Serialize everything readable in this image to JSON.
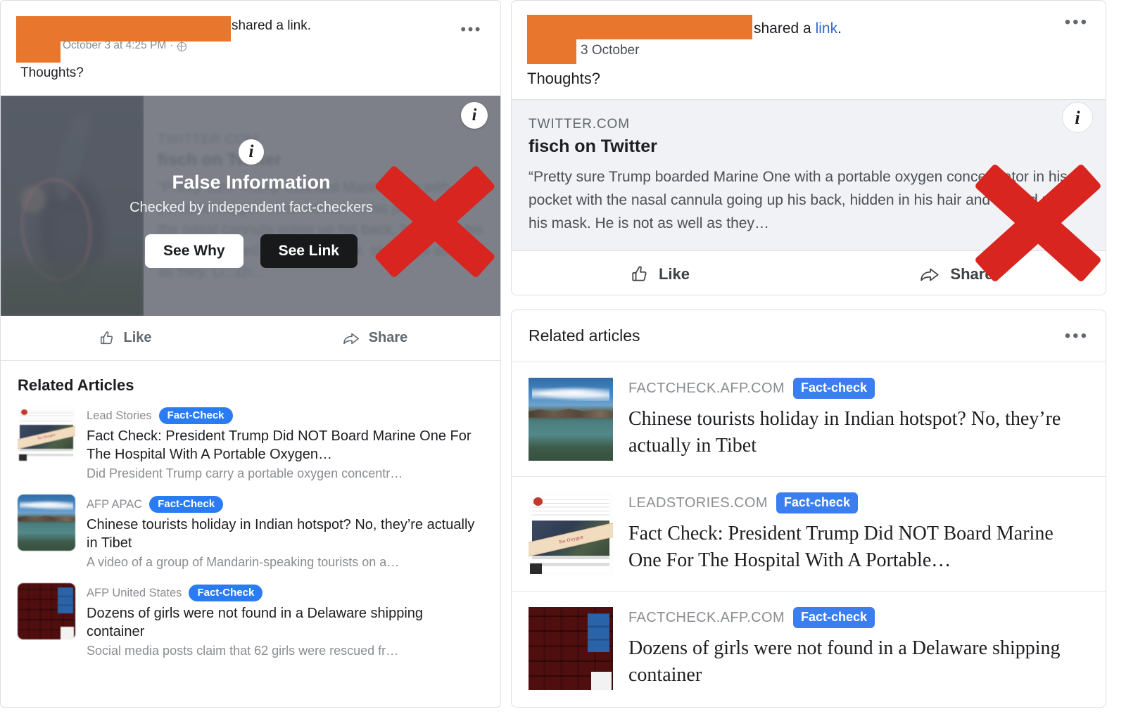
{
  "colors": {
    "redaction": "#e8762c",
    "badge_blue_left": "#2a7cf5",
    "badge_blue_right": "#3b7ef0",
    "link_blue": "#2b6bd4",
    "red_x": "#d8251f",
    "overlay_dark_button": "#18191a"
  },
  "left_panel": {
    "byline_suffix": "shared a link.",
    "timestamp": "October 3 at 4:25 PM",
    "privacy_icon": "globe-icon",
    "menu_icon": "ellipsis-icon",
    "post_text": "Thoughts?",
    "link_preview_blurred": {
      "domain": "TWITTER.COM",
      "title": "fisch on Twitter",
      "description": "\"Pretty sure Trump boarded Marine One with a portable oxygen concentrator in his pocket with the nasal cannula going up his back, hidden in his hair and tucked under his mask. He is not as well as they. Li...ch..."
    },
    "false_info_overlay": {
      "info_icon": "info-icon",
      "title": "False Information",
      "subtitle": "Checked by independent fact-checkers",
      "primary_button": "See Why",
      "secondary_button": "See Link"
    },
    "corner_info_icon": "info-icon",
    "actions": [
      {
        "label": "Like",
        "icon": "thumbs-up-icon"
      },
      {
        "label": "Share",
        "icon": "share-arrow-icon"
      }
    ],
    "related_title": "Related Articles",
    "related_articles": [
      {
        "source": "Lead Stories",
        "badge": "Fact-Check",
        "headline": "Fact Check: President Trump Did NOT Board Marine One For The Hospital With A Portable Oxygen…",
        "snippet": "Did President Trump carry a portable oxygen concentr…",
        "thumb": "leadstories-no-oxygen"
      },
      {
        "source": "AFP APAC",
        "badge": "Fact-Check",
        "headline": "Chinese tourists holiday in Indian hotspot? No, they’re actually in Tibet",
        "snippet": "A video of a group of Mandarin-speaking tourists on a…",
        "thumb": "lake-mountain"
      },
      {
        "source": "AFP United States",
        "badge": "Fact-Check",
        "headline": "Dozens of girls were not found in a Delaware shipping container",
        "snippet": "Social media posts claim that 62 girls were rescued fr…",
        "thumb": "shipping-containers"
      }
    ]
  },
  "right_panel": {
    "byline_suffix": "shared a ",
    "byline_link": "link",
    "byline_period": ".",
    "timestamp": "3 October",
    "menu_icon": "ellipsis-icon",
    "post_text": "Thoughts?",
    "link_preview": {
      "domain": "TWITTER.COM",
      "title": "fisch on Twitter",
      "description": "“Pretty sure Trump boarded Marine One with a portable oxygen concentrator in his pocket with the nasal cannula going up his back, hidden in his hair and tucked under his mask. He is not as well as they…"
    },
    "corner_info_icon": "info-icon",
    "actions": [
      {
        "label": "Like",
        "icon": "thumbs-up-icon"
      },
      {
        "label": "Share",
        "icon": "share-arrow-icon"
      }
    ],
    "related_title": "Related articles",
    "related_menu_icon": "ellipsis-icon",
    "related_articles": [
      {
        "source": "FACTCHECK.AFP.COM",
        "badge": "Fact-check",
        "headline": "Chinese tourists holiday in Indian hotspot? No, they’re actually in Tibet",
        "thumb": "lake-mountain"
      },
      {
        "source": "LEADSTORIES.COM",
        "badge": "Fact-check",
        "headline": "Fact Check: President Trump Did NOT Board Marine One For The Hospital With A Portable…",
        "thumb": "leadstories-no-oxygen"
      },
      {
        "source": "FACTCHECK.AFP.COM",
        "badge": "Fact-check",
        "headline": "Dozens of girls were not found in a Delaware shipping container",
        "thumb": "shipping-containers"
      }
    ]
  },
  "annotations": {
    "left_x_mark": "red-x-mark",
    "right_x_mark": "red-x-mark",
    "no_oxygen_stamp": "No Oxygen"
  }
}
